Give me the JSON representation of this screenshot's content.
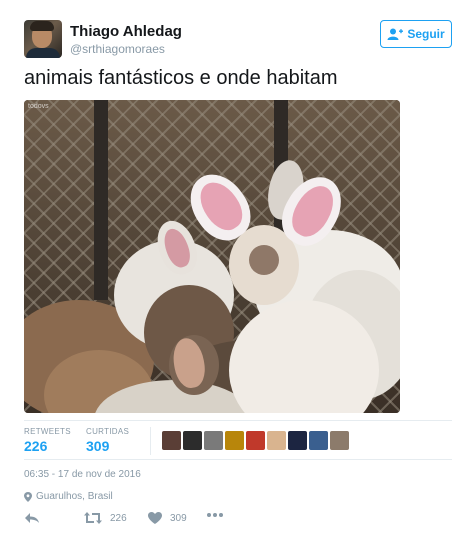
{
  "user": {
    "name": "Thiago Ahledag",
    "handle": "@srthiagomoraes"
  },
  "follow_button": {
    "label": "Seguir",
    "icon": "add-user-icon"
  },
  "tweet": {
    "text": "animais fantásticos e onde habitam",
    "photo_watermark": "todovs"
  },
  "stats": {
    "retweets_label": "RETWEETS",
    "retweets_value": "226",
    "likes_label": "CURTIDAS",
    "likes_value": "309"
  },
  "liker_avatars": [
    "#5a3e36",
    "#2c2c2c",
    "#7a7a7a",
    "#b8860b",
    "#c0392b",
    "#d9b48f",
    "#1c2541",
    "#3a5f8f",
    "#8c7b6b"
  ],
  "meta": {
    "timestamp": "06:35 - 17 de nov de 2016",
    "location": "Guarulhos, Brasil"
  },
  "actions": {
    "reply_icon": "reply-icon",
    "retweet_icon": "retweet-icon",
    "retweet_count": "226",
    "like_icon": "heart-icon",
    "like_count": "309",
    "more_icon": "more-icon"
  },
  "colors": {
    "accent": "#1da1f2",
    "muted": "#8899a6",
    "text": "#14171a"
  }
}
